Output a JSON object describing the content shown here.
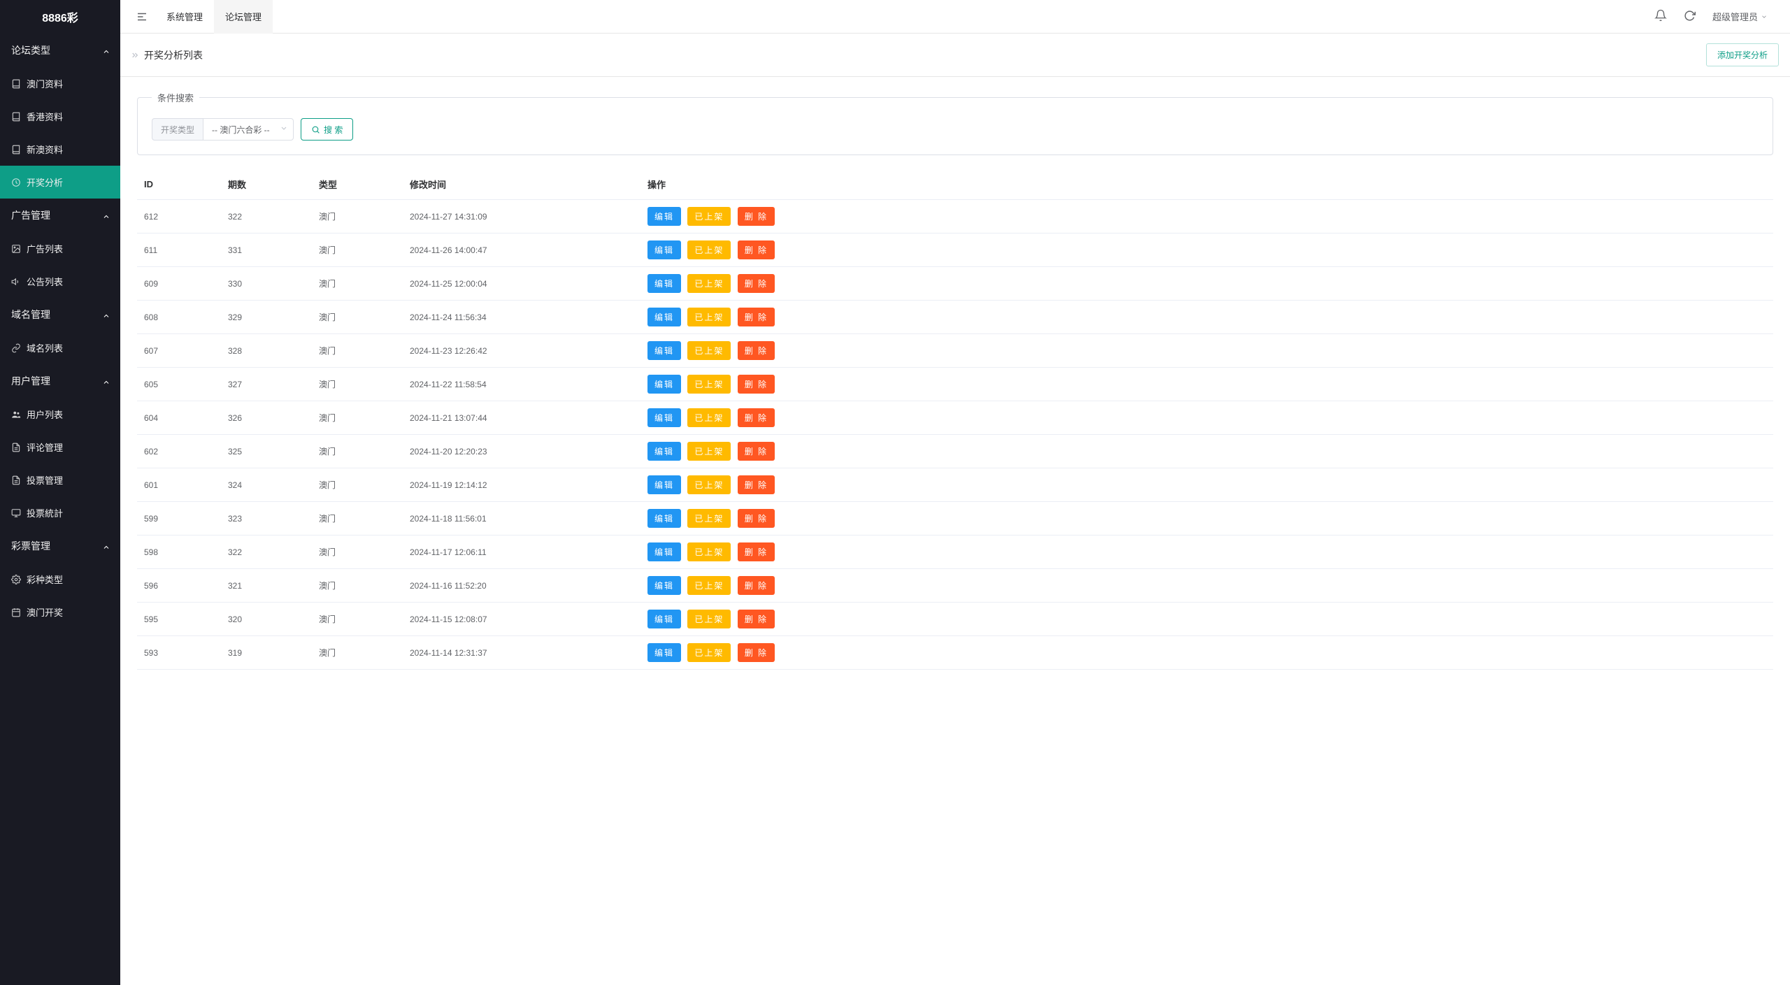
{
  "logo": "8886彩",
  "sidebar": {
    "sections": [
      {
        "header": "论坛类型",
        "items": [
          {
            "label": "澳门资料",
            "icon": "book"
          },
          {
            "label": "香港资料",
            "icon": "book"
          },
          {
            "label": "新澳资料",
            "icon": "book"
          },
          {
            "label": "开奖分析",
            "icon": "clock",
            "active": true
          }
        ]
      },
      {
        "header": "广告管理",
        "items": [
          {
            "label": "广告列表",
            "icon": "image"
          },
          {
            "label": "公告列表",
            "icon": "speaker"
          }
        ]
      },
      {
        "header": "域名管理",
        "items": [
          {
            "label": "域名列表",
            "icon": "link"
          }
        ]
      },
      {
        "header": "用户管理",
        "items": [
          {
            "label": "用户列表",
            "icon": "users"
          },
          {
            "label": "评论管理",
            "icon": "doc"
          },
          {
            "label": "投票管理",
            "icon": "doc"
          },
          {
            "label": "投票統計",
            "icon": "screen"
          }
        ]
      },
      {
        "header": "彩票管理",
        "items": [
          {
            "label": "彩种类型",
            "icon": "gear"
          },
          {
            "label": "澳门开奖",
            "icon": "calendar"
          }
        ]
      }
    ]
  },
  "header": {
    "tabs": [
      {
        "label": "系统管理"
      },
      {
        "label": "论坛管理",
        "active": true
      }
    ],
    "user": "超级管理员"
  },
  "breadcrumb": {
    "items": [
      "开奖分析列表"
    ],
    "add_btn": "添加开奖分析"
  },
  "search": {
    "legend": "条件搜索",
    "type_label": "开奖类型",
    "type_selected": "-- 澳门六合彩 --",
    "search_btn": "搜 索"
  },
  "table": {
    "headers": {
      "id": "ID",
      "period": "期数",
      "type": "类型",
      "time": "修改时间",
      "ops": "操作"
    },
    "row_buttons": {
      "edit": "编辑",
      "status": "已上架",
      "delete": "删 除"
    },
    "rows": [
      {
        "id": "612",
        "period": "322",
        "type": "澳门",
        "time": "2024-11-27 14:31:09"
      },
      {
        "id": "611",
        "period": "331",
        "type": "澳门",
        "time": "2024-11-26 14:00:47"
      },
      {
        "id": "609",
        "period": "330",
        "type": "澳门",
        "time": "2024-11-25 12:00:04"
      },
      {
        "id": "608",
        "period": "329",
        "type": "澳门",
        "time": "2024-11-24 11:56:34"
      },
      {
        "id": "607",
        "period": "328",
        "type": "澳门",
        "time": "2024-11-23 12:26:42"
      },
      {
        "id": "605",
        "period": "327",
        "type": "澳门",
        "time": "2024-11-22 11:58:54"
      },
      {
        "id": "604",
        "period": "326",
        "type": "澳门",
        "time": "2024-11-21 13:07:44"
      },
      {
        "id": "602",
        "period": "325",
        "type": "澳门",
        "time": "2024-11-20 12:20:23"
      },
      {
        "id": "601",
        "period": "324",
        "type": "澳门",
        "time": "2024-11-19 12:14:12"
      },
      {
        "id": "599",
        "period": "323",
        "type": "澳门",
        "time": "2024-11-18 11:56:01"
      },
      {
        "id": "598",
        "period": "322",
        "type": "澳门",
        "time": "2024-11-17 12:06:11"
      },
      {
        "id": "596",
        "period": "321",
        "type": "澳门",
        "time": "2024-11-16 11:52:20"
      },
      {
        "id": "595",
        "period": "320",
        "type": "澳门",
        "time": "2024-11-15 12:08:07"
      },
      {
        "id": "593",
        "period": "319",
        "type": "澳门",
        "time": "2024-11-14 12:31:37"
      }
    ]
  }
}
